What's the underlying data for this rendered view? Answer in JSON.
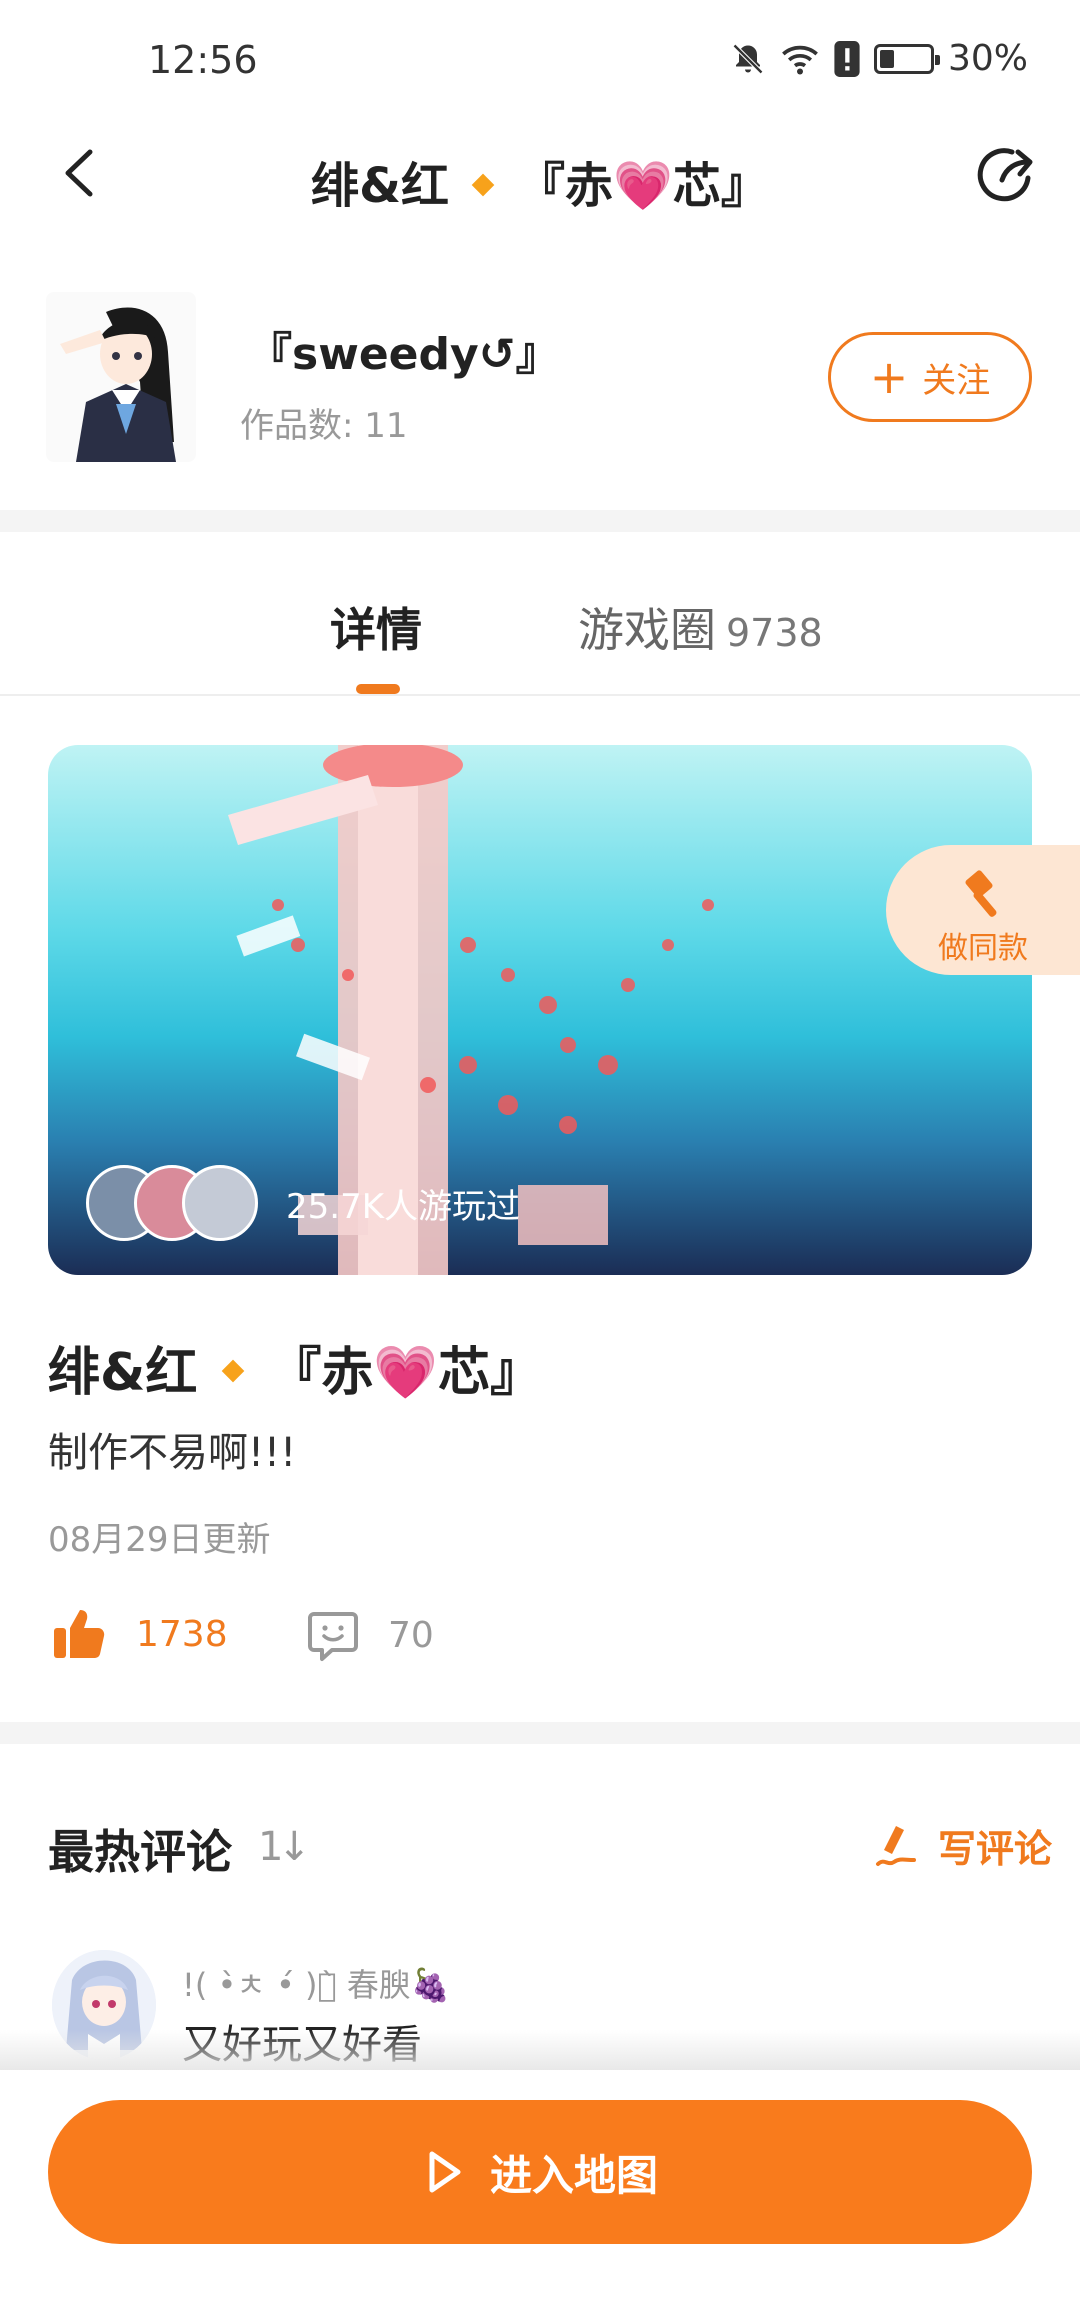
{
  "status_bar": {
    "time": "12:56",
    "battery_text": "30%",
    "battery_level": 0.3,
    "icons": [
      "bell-off-icon",
      "wifi-icon",
      "alert-icon",
      "battery-icon"
    ]
  },
  "nav": {
    "title_left": "绯&红",
    "title_right": "『赤💗芯』",
    "back_icon": "chevron-left-icon",
    "share_icon": "share-icon"
  },
  "author": {
    "name": "『sweedy↺』",
    "works_label": "作品数:",
    "works_count": "11",
    "follow_label": "关注"
  },
  "tabs": [
    {
      "label": "详情",
      "active": true
    },
    {
      "label": "游戏圈",
      "count": "9738",
      "active": false
    }
  ],
  "hero": {
    "played_text": "25.7K人游玩过"
  },
  "make_same": {
    "label": "做同款",
    "icon": "hammer-icon"
  },
  "post": {
    "title_left": "绯&红",
    "title_right": "『赤💗芯』",
    "description": "制作不易啊!!!",
    "updated": "08月29日更新",
    "likes": "1738",
    "comments": "70"
  },
  "comments_section": {
    "title": "最热评论",
    "sort_icon": "sort-icon",
    "write_label": "写评论",
    "items": [
      {
        "user": "!( •̀ㅊ •́ )ง̀ 春腴🍇",
        "text": "又好玩又好看"
      }
    ]
  },
  "bottom": {
    "enter_label": "进入地图",
    "enter_icon": "play-icon"
  },
  "colors": {
    "accent": "#f07a1e",
    "button": "#f97b1c"
  }
}
